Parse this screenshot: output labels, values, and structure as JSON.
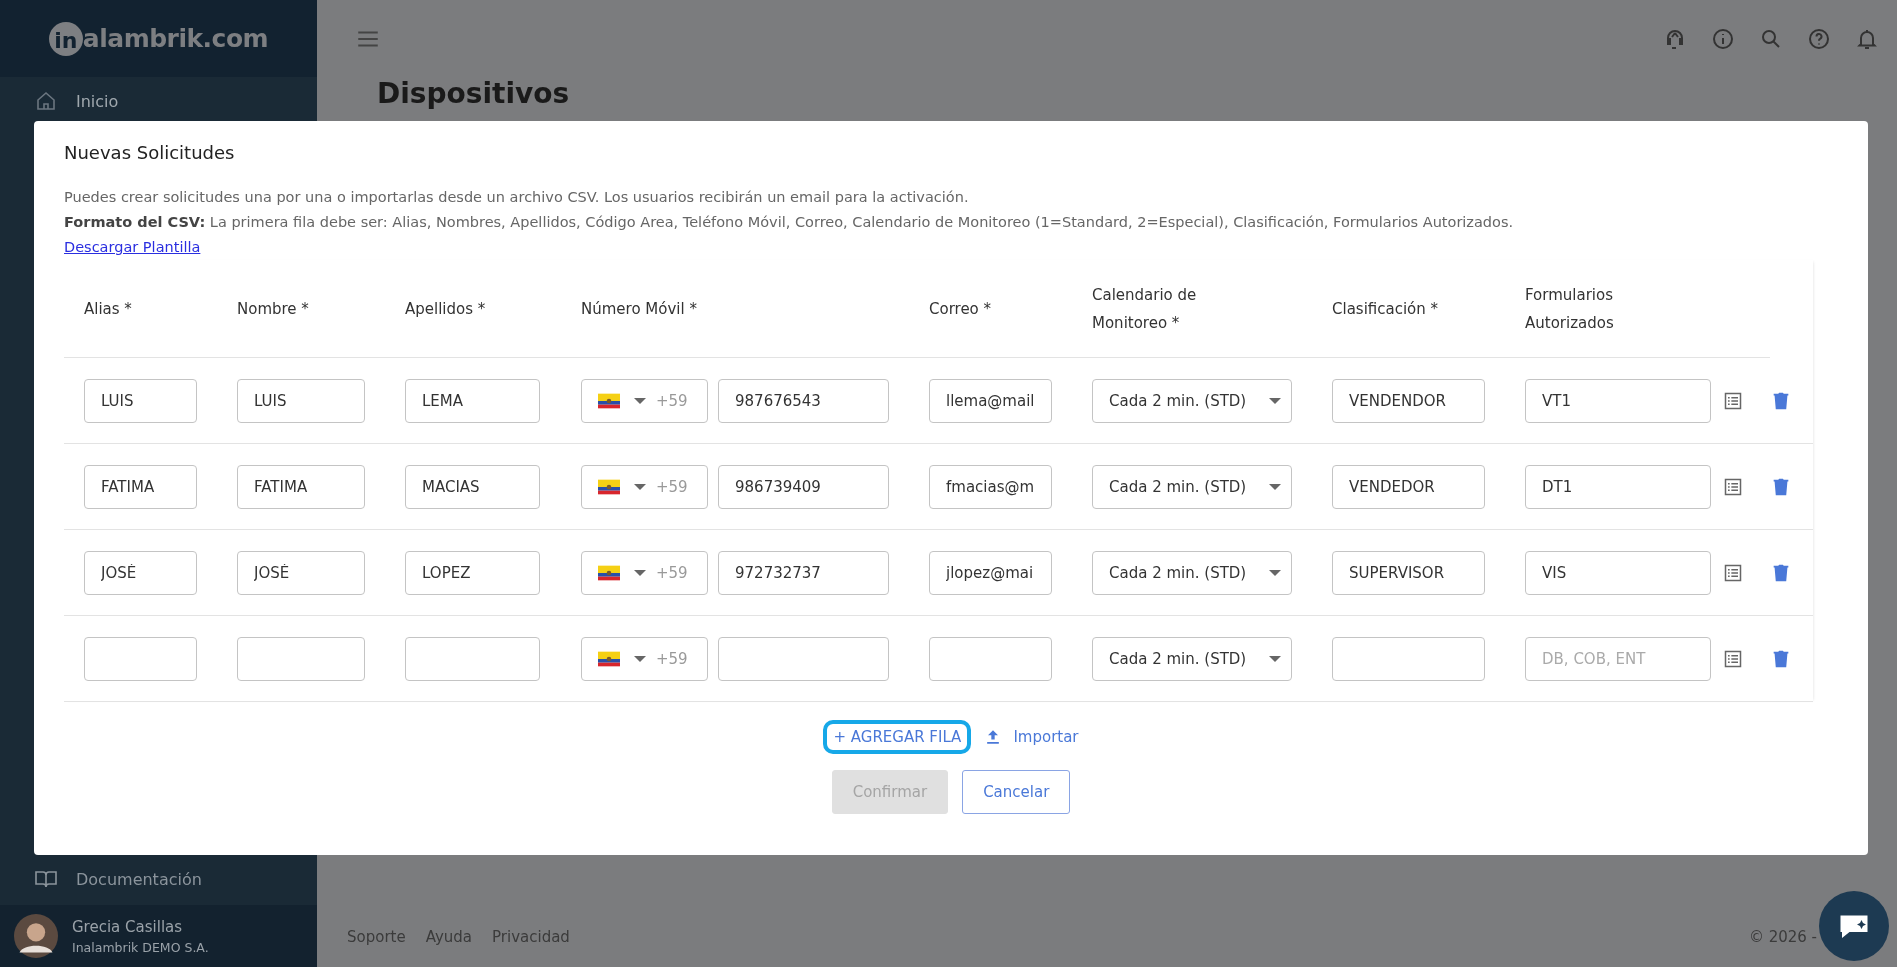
{
  "sidebar": {
    "logo_mark": "in",
    "logo_text": "alambrik.com",
    "items": [
      {
        "label": "Inicio"
      },
      {
        "label": "Documentación"
      }
    ],
    "user": {
      "name": "Grecia Casillas",
      "company": "Inalambrik DEMO S.A."
    }
  },
  "page": {
    "title": "Dispositivos"
  },
  "modal": {
    "title": "Nuevas Solicitudes",
    "description": "Puedes crear solicitudes una por una o importarlas desde un archivo CSV. Los usuarios recibirán un email para la activación.",
    "format": "**Formato del CSV:** La primera fila debe ser: Alias, Nombres, Apellidos, Código Area, Teléfono Móvil, Correo, Calendario de Monitoreo (1=Standard, 2=Especial), Clasificación, Formularios Autorizados.",
    "download_link": "Descargar Plantilla",
    "columns": [
      "Alias *",
      "Nombre *",
      "Apellidos *",
      "Número Móvil *",
      "Correo *",
      "Calendario de Monitoreo *",
      "Clasificación *",
      "Formularios Autorizados"
    ],
    "rows": [
      {
        "alias": "LUIS",
        "nombre": "LUIS",
        "apellidos": "LEMA",
        "code": "+59",
        "phone": "987676543",
        "correo": "llema@mail",
        "calendario": "Cada 2 min. (STD)",
        "clasificacion": "VENDENDOR",
        "formularios": "VT1"
      },
      {
        "alias": "FATIMA",
        "nombre": "FATIMA",
        "apellidos": "MACIAS",
        "code": "+59",
        "phone": "986739409",
        "correo": "fmacias@m",
        "calendario": "Cada 2 min. (STD)",
        "clasificacion": "VENDEDOR",
        "formularios": "DT1"
      },
      {
        "alias": "JOSÉ",
        "nombre": "JOSÉ",
        "apellidos": "LOPEZ",
        "code": "+59",
        "phone": "972732737",
        "correo": "jlopez@mai",
        "calendario": "Cada 2 min. (STD)",
        "clasificacion": "SUPERVISOR",
        "formularios": "VIS"
      },
      {
        "code": "+59",
        "calendario": "Cada 2 min. (STD)",
        "formularios_placeholder": "DB, COB, ENT"
      }
    ],
    "add_row": {
      "label": "+ AGREGAR FILA",
      "focused": true
    },
    "import": "Importar",
    "confirm": {
      "label": "Confirmar",
      "disabled": true
    },
    "cancel": "Cancelar"
  },
  "footer": {
    "links": [
      "Soporte",
      "Ayuda",
      "Privacidad"
    ],
    "copyright": "© 2026 -"
  }
}
